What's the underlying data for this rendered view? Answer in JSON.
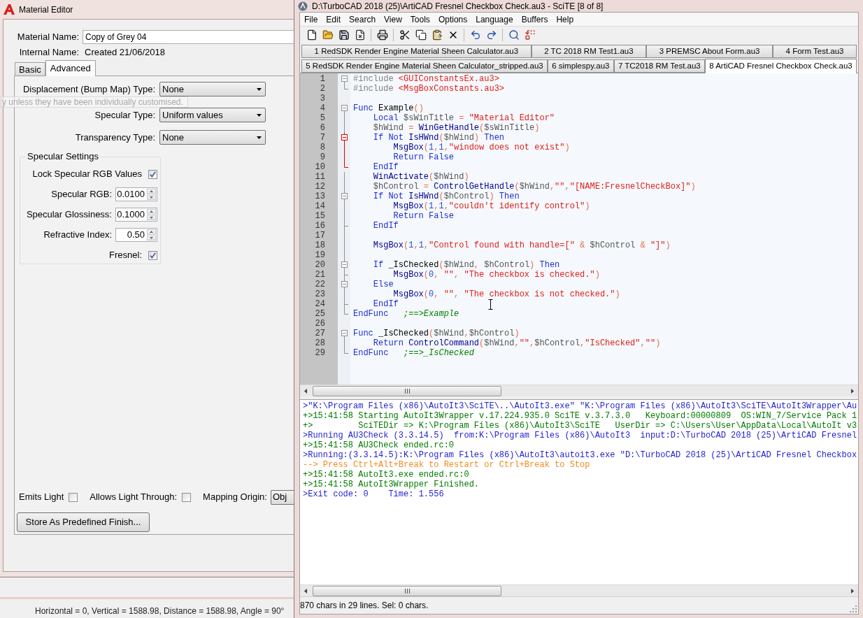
{
  "material_editor": {
    "title": "Material Editor",
    "material_name": {
      "label": "Material Name:",
      "value": "Copy of Grey 04"
    },
    "internal_name": {
      "label": "Internal Name:",
      "value": "Created 21/06/2018"
    },
    "tabs": [
      {
        "label": "Basic",
        "selected": false
      },
      {
        "label": "Advanced",
        "selected": true
      }
    ],
    "type_rows": [
      {
        "label": "Displacement (Bump Map) Type:",
        "value": "None"
      },
      {
        "label": "Specular Type:",
        "value": "Uniform values"
      },
      {
        "label": "Transparency Type:",
        "value": "None"
      }
    ],
    "tooltip": "y unless they have been individually customised.",
    "specular_settings": {
      "title": "Specular Settings",
      "rows": [
        {
          "kind": "checkbox",
          "label": "Lock Specular RGB Values",
          "checked": true
        },
        {
          "kind": "spin",
          "label": "Specular RGB:",
          "value": "0.0100"
        },
        {
          "kind": "spin",
          "label": "Specular Glossiness:",
          "value": "0.1000"
        },
        {
          "kind": "spin",
          "label": "Refractive Index:",
          "value": "0.50"
        },
        {
          "kind": "checkbox",
          "label": "Fresnel:",
          "checked": true
        }
      ]
    },
    "options": [
      {
        "kind": "checkbox",
        "label": "Emits Light",
        "checked": false
      },
      {
        "kind": "checkbox",
        "label": "Allows Light Through:",
        "checked": false
      },
      {
        "kind": "dropdown",
        "label": "Mapping Origin:",
        "value": "Obj"
      }
    ],
    "store_button": "Store As Predefined Finish..."
  },
  "desktop_status": "Horizontal = 0, Vertical = 1588.98, Distance = 1588.98, Angle = 90°",
  "scite": {
    "title": "D:\\TurboCAD 2018 (25)\\ArtiCAD Fresnel Checkbox Check.au3 - SciTE [8 of 8]",
    "menu": [
      "File",
      "Edit",
      "Search",
      "View",
      "Tools",
      "Options",
      "Language",
      "Buffers",
      "Help"
    ],
    "buffer_tabs": [
      {
        "tabs": [
          {
            "label": "1 RedSDK Render Engine Material Sheen Calculator.au3",
            "selected": false
          },
          {
            "label": "2 TC 2018 RM Test1.au3",
            "selected": false
          },
          {
            "label": "3 PREMSC About Form.au3",
            "selected": false
          },
          {
            "label": "4 Form Test.au3",
            "selected": false
          }
        ]
      },
      {
        "tabs": [
          {
            "label": "5 RedSDK Render Engine Material Sheen Calculator_stripped.au3",
            "selected": false
          },
          {
            "label": "6 simplespy.au3",
            "selected": false
          },
          {
            "label": "7 TC2018 RM Test.au3",
            "selected": false
          },
          {
            "label": "8 ArtiCAD Fresnel Checkbox Check.au3",
            "selected": true
          }
        ]
      }
    ],
    "editor": {
      "lines": [
        {
          "number": "1",
          "fold": {
            "kind": "box",
            "highlight": false
          },
          "tokens": [
            {
              "kind": "directive",
              "text": "#include "
            },
            {
              "kind": "string",
              "text": "<GUIConstantsEx.au3>"
            }
          ]
        },
        {
          "number": "2",
          "fold": {
            "kind": "end",
            "highlight": false
          },
          "tokens": [
            {
              "kind": "directive",
              "text": "#include "
            },
            {
              "kind": "string",
              "text": "<MsgBoxConstants.au3>"
            }
          ]
        },
        {
          "number": "3"
        },
        {
          "number": "4",
          "fold": {
            "kind": "box",
            "highlight": false
          },
          "tokens": [
            {
              "kind": "keyword",
              "text": "Func "
            },
            {
              "kind": "plain",
              "text": "Example"
            },
            {
              "kind": "operator",
              "text": "()"
            }
          ]
        },
        {
          "number": "5",
          "fold": {
            "kind": "line",
            "highlight": false
          },
          "tokens": [
            {
              "kind": "keyword",
              "text": "    Local "
            },
            {
              "kind": "variable",
              "text": "$sWinTitle "
            },
            {
              "kind": "operator",
              "text": "= "
            },
            {
              "kind": "string",
              "text": "\"Material Editor\""
            }
          ]
        },
        {
          "number": "6",
          "fold": {
            "kind": "line",
            "highlight": false
          },
          "tokens": [
            {
              "kind": "variable",
              "text": "    $hWind "
            },
            {
              "kind": "operator",
              "text": "= "
            },
            {
              "kind": "function",
              "text": "WinGetHandle"
            },
            {
              "kind": "operator",
              "text": "("
            },
            {
              "kind": "variable",
              "text": "$sWinTitle"
            },
            {
              "kind": "operator",
              "text": ")"
            }
          ]
        },
        {
          "number": "7",
          "fold": {
            "kind": "subbox",
            "highlight": true
          },
          "tokens": [
            {
              "kind": "keyword",
              "text": "    If Not "
            },
            {
              "kind": "function",
              "text": "IsHWnd"
            },
            {
              "kind": "operator",
              "text": "("
            },
            {
              "kind": "variable",
              "text": "$hWind"
            },
            {
              "kind": "operator",
              "text": ") "
            },
            {
              "kind": "keyword",
              "text": "Then"
            }
          ]
        },
        {
          "number": "8",
          "fold": {
            "kind": "line",
            "highlight": true
          },
          "tokens": [
            {
              "kind": "function",
              "text": "        MsgBox"
            },
            {
              "kind": "operator",
              "text": "("
            },
            {
              "kind": "number",
              "text": "1"
            },
            {
              "kind": "operator",
              "text": ","
            },
            {
              "kind": "number",
              "text": "1"
            },
            {
              "kind": "operator",
              "text": ","
            },
            {
              "kind": "string",
              "text": "\"window does not exist\""
            },
            {
              "kind": "operator",
              "text": ")"
            }
          ]
        },
        {
          "number": "9",
          "fold": {
            "kind": "line",
            "highlight": true
          },
          "tokens": [
            {
              "kind": "keyword",
              "text": "        Return False"
            }
          ]
        },
        {
          "number": "10",
          "fold": {
            "kind": "end",
            "highlight": true
          },
          "tokens": [
            {
              "kind": "keyword",
              "text": "    EndIf"
            }
          ]
        },
        {
          "number": "11",
          "fold": {
            "kind": "line",
            "highlight": false
          },
          "tokens": [
            {
              "kind": "function",
              "text": "    WinActivate"
            },
            {
              "kind": "operator",
              "text": "("
            },
            {
              "kind": "variable",
              "text": "$hWind"
            },
            {
              "kind": "operator",
              "text": ")"
            }
          ]
        },
        {
          "number": "12",
          "fold": {
            "kind": "line",
            "highlight": false
          },
          "tokens": [
            {
              "kind": "variable",
              "text": "    $hControl "
            },
            {
              "kind": "operator",
              "text": "= "
            },
            {
              "kind": "function",
              "text": "ControlGetHandle"
            },
            {
              "kind": "operator",
              "text": "("
            },
            {
              "kind": "variable",
              "text": "$hWind"
            },
            {
              "kind": "operator",
              "text": ","
            },
            {
              "kind": "string",
              "text": "\"\""
            },
            {
              "kind": "operator",
              "text": ","
            },
            {
              "kind": "string",
              "text": "\"[NAME:FresnelCheckBox]\""
            },
            {
              "kind": "operator",
              "text": ")"
            }
          ]
        },
        {
          "number": "13",
          "fold": {
            "kind": "subbox",
            "highlight": false
          },
          "tokens": [
            {
              "kind": "keyword",
              "text": "    If Not "
            },
            {
              "kind": "function",
              "text": "IsHWnd"
            },
            {
              "kind": "operator",
              "text": "("
            },
            {
              "kind": "variable",
              "text": "$hControl"
            },
            {
              "kind": "operator",
              "text": ") "
            },
            {
              "kind": "keyword",
              "text": "Then"
            }
          ]
        },
        {
          "number": "14",
          "fold": {
            "kind": "line",
            "highlight": false
          },
          "tokens": [
            {
              "kind": "function",
              "text": "        MsgBox"
            },
            {
              "kind": "operator",
              "text": "("
            },
            {
              "kind": "number",
              "text": "1"
            },
            {
              "kind": "operator",
              "text": ","
            },
            {
              "kind": "number",
              "text": "1"
            },
            {
              "kind": "operator",
              "text": ","
            },
            {
              "kind": "string",
              "text": "\"couldn't identify control\""
            },
            {
              "kind": "operator",
              "text": ")"
            }
          ]
        },
        {
          "number": "15",
          "fold": {
            "kind": "line",
            "highlight": false
          },
          "tokens": [
            {
              "kind": "keyword",
              "text": "        Return False"
            }
          ]
        },
        {
          "number": "16",
          "fold": {
            "kind": "tee",
            "highlight": false
          },
          "tokens": [
            {
              "kind": "keyword",
              "text": "    EndIf"
            }
          ]
        },
        {
          "number": "17",
          "fold": {
            "kind": "line",
            "highlight": false
          }
        },
        {
          "number": "18",
          "fold": {
            "kind": "line",
            "highlight": false
          },
          "tokens": [
            {
              "kind": "function",
              "text": "    MsgBox"
            },
            {
              "kind": "operator",
              "text": "("
            },
            {
              "kind": "number",
              "text": "1"
            },
            {
              "kind": "operator",
              "text": ","
            },
            {
              "kind": "number",
              "text": "1"
            },
            {
              "kind": "operator",
              "text": ","
            },
            {
              "kind": "string",
              "text": "\"Control found with handle=[\""
            },
            {
              "kind": "operator",
              "text": " & "
            },
            {
              "kind": "variable",
              "text": "$hControl"
            },
            {
              "kind": "operator",
              "text": " & "
            },
            {
              "kind": "string",
              "text": "\"]\""
            },
            {
              "kind": "operator",
              "text": ")"
            }
          ]
        },
        {
          "number": "19",
          "fold": {
            "kind": "line",
            "highlight": false
          }
        },
        {
          "number": "20",
          "fold": {
            "kind": "subbox",
            "highlight": false
          },
          "tokens": [
            {
              "kind": "keyword",
              "text": "    If "
            },
            {
              "kind": "plain",
              "text": "_IsChecked"
            },
            {
              "kind": "operator",
              "text": "("
            },
            {
              "kind": "variable",
              "text": "$hWind"
            },
            {
              "kind": "operator",
              "text": ", "
            },
            {
              "kind": "variable",
              "text": "$hControl"
            },
            {
              "kind": "operator",
              "text": ") "
            },
            {
              "kind": "keyword",
              "text": "Then"
            }
          ]
        },
        {
          "number": "21",
          "fold": {
            "kind": "tee",
            "highlight": false
          },
          "tokens": [
            {
              "kind": "function",
              "text": "        MsgBox"
            },
            {
              "kind": "operator",
              "text": "("
            },
            {
              "kind": "number",
              "text": "0"
            },
            {
              "kind": "operator",
              "text": ", "
            },
            {
              "kind": "string",
              "text": "\"\""
            },
            {
              "kind": "operator",
              "text": ", "
            },
            {
              "kind": "string",
              "text": "\"The checkbox is checked.\""
            },
            {
              "kind": "operator",
              "text": ")"
            }
          ]
        },
        {
          "number": "22",
          "fold": {
            "kind": "subbox",
            "highlight": false
          },
          "tokens": [
            {
              "kind": "keyword",
              "text": "    Else"
            }
          ]
        },
        {
          "number": "23",
          "fold": {
            "kind": "line",
            "highlight": false
          },
          "tokens": [
            {
              "kind": "function",
              "text": "        MsgBox"
            },
            {
              "kind": "operator",
              "text": "("
            },
            {
              "kind": "number",
              "text": "0"
            },
            {
              "kind": "operator",
              "text": ", "
            },
            {
              "kind": "string",
              "text": "\"\""
            },
            {
              "kind": "operator",
              "text": ", "
            },
            {
              "kind": "string",
              "text": "\"The checkbox is not checked.\""
            },
            {
              "kind": "operator",
              "text": ")"
            }
          ]
        },
        {
          "number": "24",
          "fold": {
            "kind": "tee",
            "highlight": false
          },
          "tokens": [
            {
              "kind": "keyword",
              "text": "    EndIf"
            }
          ]
        },
        {
          "number": "25",
          "fold": {
            "kind": "end",
            "highlight": false
          },
          "tokens": [
            {
              "kind": "keyword",
              "text": "EndFunc"
            },
            {
              "kind": "comment",
              "text": "   ;==>Example"
            }
          ]
        },
        {
          "number": "26"
        },
        {
          "number": "27",
          "fold": {
            "kind": "box",
            "highlight": false
          },
          "tokens": [
            {
              "kind": "keyword",
              "text": "Func "
            },
            {
              "kind": "plain",
              "text": "_IsChecked"
            },
            {
              "kind": "operator",
              "text": "("
            },
            {
              "kind": "variable",
              "text": "$hWind"
            },
            {
              "kind": "operator",
              "text": ","
            },
            {
              "kind": "variable",
              "text": "$hControl"
            },
            {
              "kind": "operator",
              "text": ")"
            }
          ]
        },
        {
          "number": "28",
          "fold": {
            "kind": "line",
            "highlight": false
          },
          "tokens": [
            {
              "kind": "keyword",
              "text": "    Return "
            },
            {
              "kind": "function",
              "text": "ControlCommand"
            },
            {
              "kind": "operator",
              "text": "("
            },
            {
              "kind": "variable",
              "text": "$hWind"
            },
            {
              "kind": "operator",
              "text": ","
            },
            {
              "kind": "string",
              "text": "\"\""
            },
            {
              "kind": "operator",
              "text": ","
            },
            {
              "kind": "variable",
              "text": "$hControl"
            },
            {
              "kind": "operator",
              "text": ","
            },
            {
              "kind": "string",
              "text": "\"IsChecked\""
            },
            {
              "kind": "operator",
              "text": ","
            },
            {
              "kind": "string",
              "text": "\"\""
            },
            {
              "kind": "operator",
              "text": ")"
            }
          ]
        },
        {
          "number": "29",
          "fold": {
            "kind": "end",
            "highlight": false
          },
          "tokens": [
            {
              "kind": "keyword",
              "text": "EndFunc"
            },
            {
              "kind": "comment",
              "text": "   ;==>_IsChecked"
            }
          ]
        }
      ]
    },
    "output": [
      {
        "kind": "command",
        "text": ">\"K:\\Program Files (x86)\\AutoIt3\\SciTE\\..\\AutoIt3.exe\" \"K:\\Program Files (x86)\\AutoIt3\\SciTE\\AutoIt3Wrapper\\Au"
      },
      {
        "kind": "success",
        "text": "+>15:41:58 Starting AutoIt3Wrapper v.17.224.935.0 SciTE v.3.7.3.0   Keyboard:00000809  OS:WIN_7/Service Pack 1"
      },
      {
        "kind": "success",
        "text": "+>         SciTEDir => K:\\Program Files (x86)\\AutoIt3\\SciTE   UserDir => C:\\Users\\User\\AppData\\Local\\AutoIt v3"
      },
      {
        "kind": "command",
        "text": ">Running AU3Check (3.3.14.5)  from:K:\\Program Files (x86)\\AutoIt3  input:D:\\TurboCAD 2018 (25)\\ArtiCAD Fresnel"
      },
      {
        "kind": "success",
        "text": "+>15:41:58 AU3Check ended.rc:0"
      },
      {
        "kind": "command",
        "text": ">Running:(3.3.14.5):K:\\Program Files (x86)\\AutoIt3\\autoit3.exe \"D:\\TurboCAD 2018 (25)\\ArtiCAD Fresnel Checkbox"
      },
      {
        "kind": "warning",
        "text": "--> Press Ctrl+Alt+Break to Restart or Ctrl+Break to Stop"
      },
      {
        "kind": "success",
        "text": "+>15:41:58 AutoIt3.exe ended.rc:0"
      },
      {
        "kind": "success",
        "text": "+>15:41:58 AutoIt3Wrapper Finished."
      },
      {
        "kind": "command",
        "text": ">Exit code: 0    Time: 1.556"
      }
    ],
    "status_bar": "870 chars in 29 lines. Sel: 0 chars."
  }
}
